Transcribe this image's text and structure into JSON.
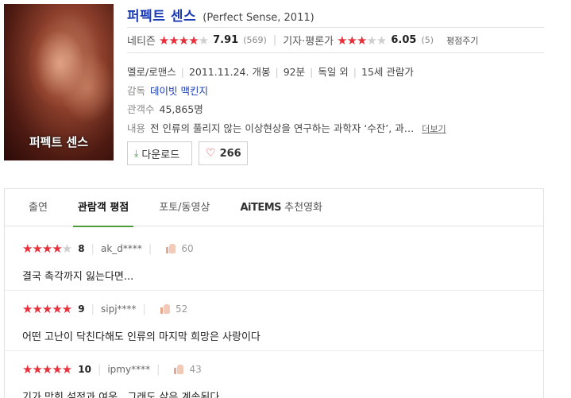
{
  "movie": {
    "poster_title": "퍼펙트 센스",
    "title": "퍼펙트 센스",
    "original": "(Perfect Sense, 2011)",
    "netizen_label": "네티즌",
    "netizen_score": "7.91",
    "netizen_count": "(569)",
    "critic_label": "기자·평론가",
    "critic_score": "6.05",
    "critic_count": "(5)",
    "rate_label": "평점주기",
    "genre": "멜로/로맨스",
    "release": "2011.11.24. 개봉",
    "runtime": "92분",
    "country": "독일 외",
    "age": "15세 관람가",
    "director_label": "감독",
    "director": "데이빗 맥킨지",
    "audience_label": "관객수",
    "audience": "45,865명",
    "plot_label": "내용",
    "plot": "전 인류의 풀리지 않는 이상현상을 연구하는 과학자 ‘수잔’, 과…",
    "more_label": "더보기",
    "download_label": "다운로드",
    "like_count": "266"
  },
  "tabs": [
    {
      "label": "출연"
    },
    {
      "label": "관람객 평점"
    },
    {
      "label": "포토/동영상"
    },
    {
      "label": "AiTEMS",
      "suffix": "추천영화"
    }
  ],
  "reviews": [
    {
      "score": "8",
      "user": "ak_d****",
      "likes": "60",
      "text": "결국 촉각까지 잃는다면..."
    },
    {
      "score": "9",
      "user": "sipj****",
      "likes": "52",
      "text": "어떤 고난이 닥친다해도 인류의 마지막 희망은 사랑이다"
    },
    {
      "score": "10",
      "user": "ipmy****",
      "likes": "43",
      "text": "기가 막힌 설정과 여운...그래도 삶은 계속된다."
    }
  ],
  "colors": {
    "accent": "#1a3bb5",
    "star": "#e8303c",
    "tab_underline": "#4d9e3a"
  }
}
